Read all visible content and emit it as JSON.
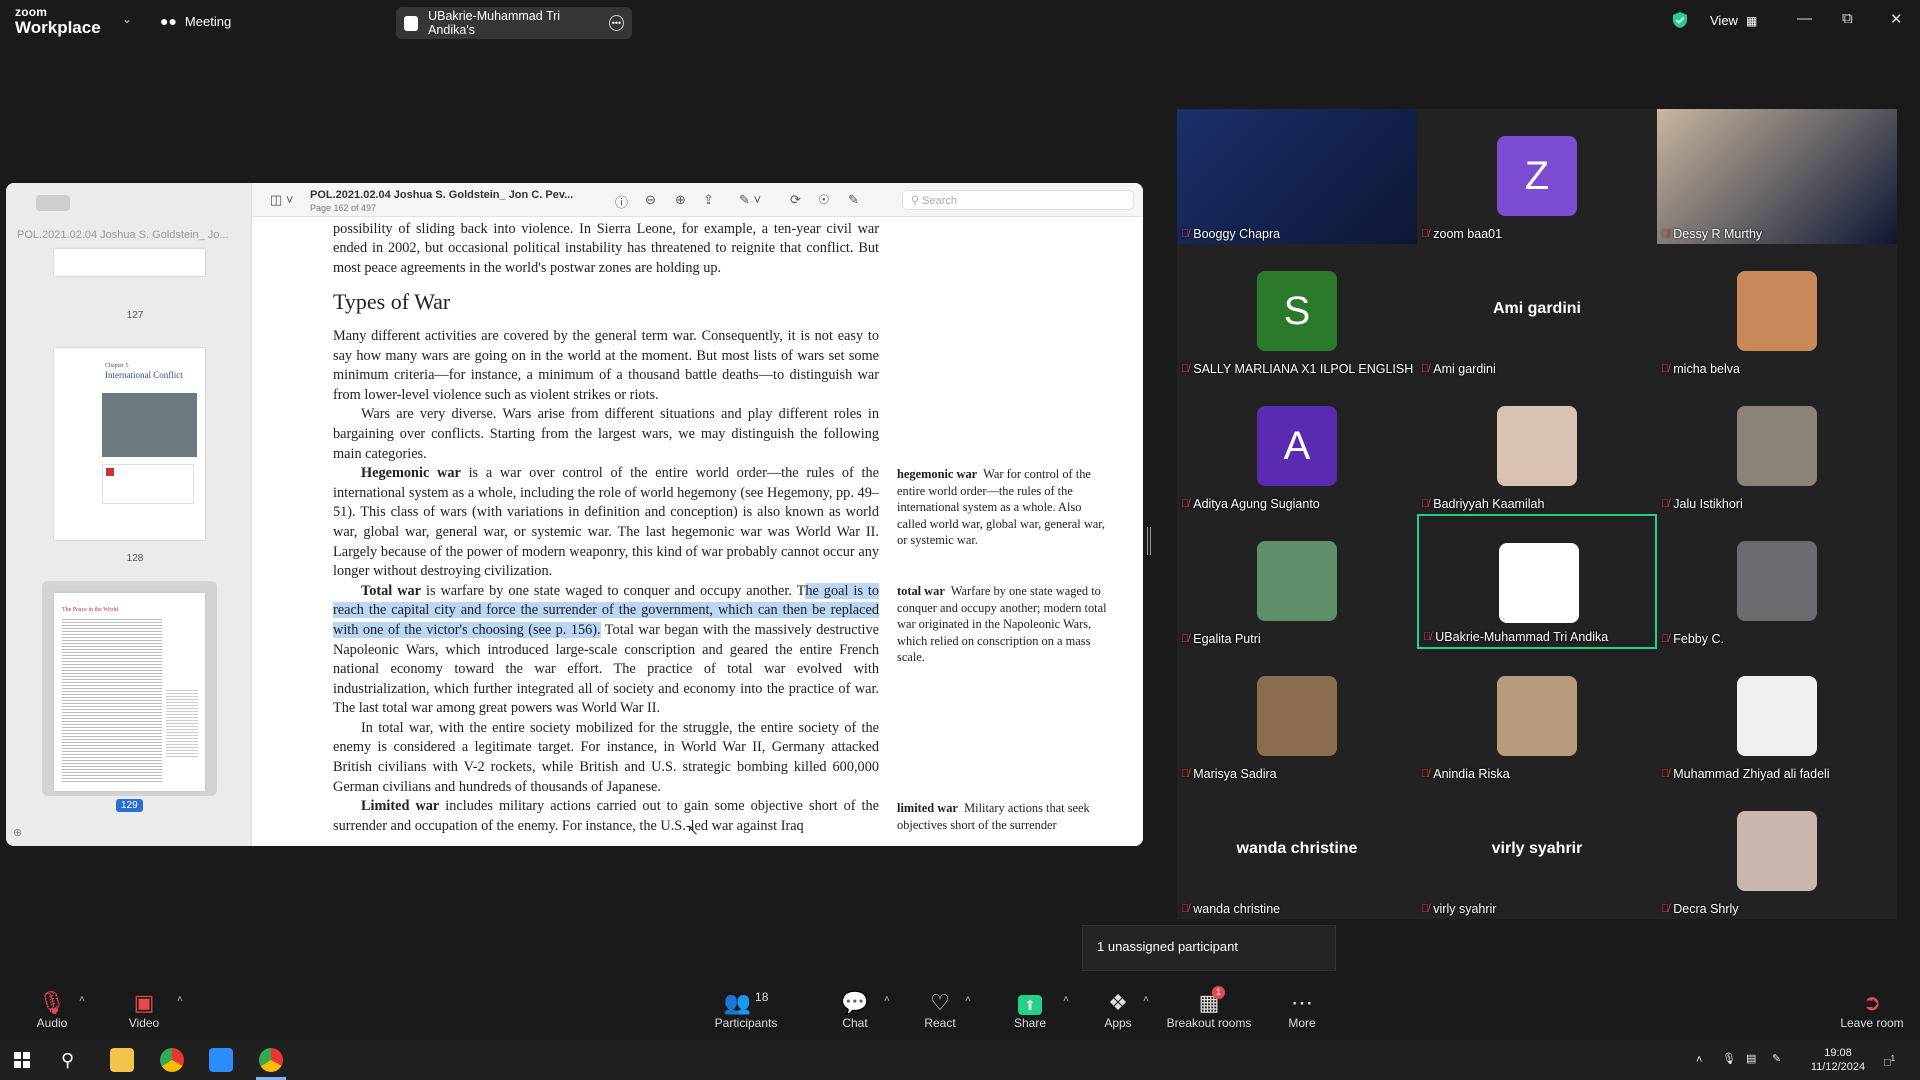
{
  "topbar": {
    "logo_line1": "zoom",
    "logo_line2": "Workplace",
    "meeting_label": "Meeting",
    "share_title": "UBakrie-Muhammad Tri Andika's",
    "view_label": "View"
  },
  "pdf": {
    "file_title": "POL.2021.02.04 Joshua S. Goldstein_ Jon C. Pev...",
    "page_info": "Page 162 of 497",
    "sidebar_title": "POL.2021.02.04 Joshua S. Goldstein_ Jo...",
    "search_placeholder": "Search",
    "thumbnails": [
      {
        "num": "127"
      },
      {
        "num": "128",
        "chapter": "Chapter 5",
        "heading": "International Conflict"
      },
      {
        "num": "129",
        "heading": "The Peace in the World"
      }
    ],
    "text": {
      "p0": "have ended. Some of the countries in these zones still face difficult postwar years with the possibility of sliding back into violence. In Sierra Leone, for example, a ten-year civil war ended in 2002, but occasional political instability has threatened to reignite that conflict. But most peace agreements in the world's postwar zones are holding up.",
      "heading": "Types of War",
      "p1": "Many different activities are covered by the general term war. Consequently, it is not easy to say how many wars are going on in the world at the moment. But most lists of wars set some minimum criteria—for instance, a minimum of a thousand battle deaths—to distinguish war from lower-level violence such as violent strikes or riots.",
      "p2": "Wars are very diverse. Wars arise from different situations and play different roles in bargaining over conflicts. Starting from the largest wars, we may distinguish the following main categories.",
      "p3_term": "Hegemonic war",
      "p3": " is a war over control of the entire world order—the rules of the international system as a whole, including the role of world hegemony (see Hegemony, pp. 49–51). This class of wars (with variations in definition and conception) is also known as world war, global war, general war, or systemic war. The last hegemonic war was World War II. Largely because of the power of modern weaponry, this kind of war probably cannot occur any longer without destroying civilization.",
      "p4_term": "Total war",
      "p4_a": " is warfare by one state waged to conquer and occupy another. T",
      "p4_hl": "he goal is to reach the capital city and force the surrender of the government, which can then be replaced with one of the victor's choosing (see p. 156).",
      "p4_b": " Total war began with the massively destructive Napoleonic Wars, which introduced large-scale conscription and geared the entire French national economy toward the war effort. The practice of total war evolved with industrialization, which further integrated all of society and economy into the practice of war. The last total war among great powers was World War II.",
      "p5": "In total war, with the entire society mobilized for the struggle, the entire society of the enemy is considered a legitimate target. For instance, in World War II, Germany attacked British civilians with V-2 rockets, while British and U.S. strategic bombing killed 600,000 German civilians and hundreds of thousands of Japanese.",
      "p6_term": "Limited war",
      "p6": " includes military actions carried out to gain some objective short of the surrender and occupation of the enemy. For instance, the U.S.-led war against Iraq",
      "note1_term": "hegemonic war",
      "note1": "War for control of the entire world order—the rules of the international system as a whole. Also called world war, global war, general war, or systemic war.",
      "note2_term": "total war",
      "note2": "Warfare by one state waged to conquer and occupy another; modern total war originated in the Napoleonic Wars, which relied on conscription on a mass scale.",
      "note3_term": "limited war",
      "note3": "Military actions that seek objectives short of the surrender"
    }
  },
  "participants": [
    {
      "name": "Booggy Chapra",
      "type": "video",
      "color": "#1b2f6b"
    },
    {
      "name": "zoom baa01",
      "type": "letter",
      "letter": "Z",
      "color": "#7b4bd1"
    },
    {
      "name": "Dessy R Murthy",
      "type": "video",
      "color": "#c9b7a0"
    },
    {
      "name": "SALLY MARLIANA X1 ILPOL ENGLISH",
      "type": "letter",
      "letter": "S",
      "color": "#2b7a2b"
    },
    {
      "name": "Ami gardini",
      "type": "text"
    },
    {
      "name": "micha belva",
      "type": "photo",
      "color": "#c9885a"
    },
    {
      "name": "Aditya Agung Sugianto",
      "type": "letter",
      "letter": "A",
      "color": "#5a2bb0"
    },
    {
      "name": "Badriyyah Kaamilah",
      "type": "photo",
      "color": "#d9c3b0"
    },
    {
      "name": "Jalu Istikhori",
      "type": "photo",
      "color": "#8b8278"
    },
    {
      "name": "Egalita Putri",
      "type": "photo",
      "color": "#5f8e6a"
    },
    {
      "name": "UBakrie-Muhammad Tri Andika",
      "type": "blank",
      "active": true
    },
    {
      "name": "Febby C.",
      "type": "photo",
      "color": "#6b6b70"
    },
    {
      "name": "Marisya Sadira",
      "type": "photo",
      "color": "#8a6d4e"
    },
    {
      "name": "Anindia Riska",
      "type": "photo",
      "color": "#b59a7c"
    },
    {
      "name": "Muhammad Zhiyad ali fadeli",
      "type": "photo",
      "color": "#f0f0f0"
    },
    {
      "name": "wanda christine",
      "type": "text"
    },
    {
      "name": "virly syahrir",
      "type": "text"
    },
    {
      "name": "Decra Shrly",
      "type": "photo",
      "color": "#c8b6ad"
    }
  ],
  "unassigned": "1 unassigned participant",
  "toolbar": {
    "audio": "Audio",
    "video": "Video",
    "participants": "Participants",
    "participants_count": "18",
    "chat": "Chat",
    "react": "React",
    "share": "Share",
    "apps": "Apps",
    "breakout": "Breakout rooms",
    "breakout_badge": "1",
    "more": "More",
    "leave": "Leave room"
  },
  "taskbar": {
    "time": "19:08",
    "date": "11/12/2024",
    "notif_count": "1"
  },
  "colors": {
    "accent_green": "#23d18b",
    "mic_red": "#e5484d",
    "highlight": "#bcd6f5",
    "page_badge": "#2a6fd6"
  }
}
